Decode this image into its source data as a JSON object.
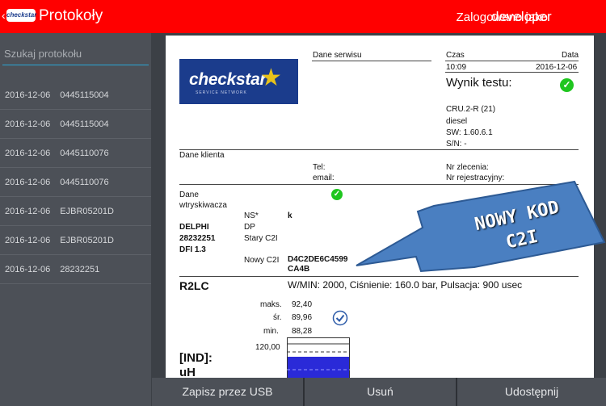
{
  "header": {
    "back_glyph": "‹",
    "logo_text": "checkstar",
    "title": "Protokoły",
    "login_label": "Zalogowano jako",
    "username": "developer"
  },
  "sidebar": {
    "search_placeholder": "Szukaj protokołu",
    "items": [
      {
        "date": "2016-12-06",
        "code": "0445115004"
      },
      {
        "date": "2016-12-06",
        "code": "0445115004"
      },
      {
        "date": "2016-12-06",
        "code": "0445110076"
      },
      {
        "date": "2016-12-06",
        "code": "0445110076"
      },
      {
        "date": "2016-12-06",
        "code": "EJBR05201D"
      },
      {
        "date": "2016-12-06",
        "code": "EJBR05201D"
      },
      {
        "date": "2016-12-06",
        "code": "28232251"
      }
    ]
  },
  "report": {
    "logo_text": "checkstar",
    "logo_sub": "SERVICE NETWORK",
    "service_label": "Dane serwisu",
    "time_label": "Czas",
    "date_label": "Data",
    "time_value": "10:09",
    "date_value": "2016-12-06",
    "result_label": "Wynik testu:",
    "device_model": "CRU.2-R (21)",
    "device_fuel": "diesel",
    "device_sw": "SW: 1.60.6.1",
    "device_sn": "S/N: -",
    "client_label": "Dane klienta",
    "tel_label": "Tel:",
    "email_label": "email:",
    "order_label": "Nr zlecenia:",
    "reg_label": "Nr rejestracyjny:",
    "injector_label_1": "Dane",
    "injector_label_2": "wtryskiwacza",
    "ns_label": "NS*",
    "ns_value": "k",
    "dp_label": "DP",
    "old_c2i_label": "Stary C2I",
    "new_c2i_label": "Nowy C2I",
    "new_c2i_value_1": "D4C2DE6C4599",
    "new_c2i_value_2": "CA4B",
    "maker": "DELPHI",
    "part_no": "28232251",
    "injector_model": "DFI 1.3",
    "test_name": "R2LC",
    "test_params": "W/MIN: 2000, Ciśnienie: 160.0 bar, Pulsacja: 900 usec",
    "max_label": "maks.",
    "max_value": "92,40",
    "avg_label": "śr.",
    "avg_value": "89,96",
    "min_label": "min.",
    "min_value": "88,28",
    "scale_top": "120,00",
    "ind_label_1": "[IND]:",
    "ind_label_2": "uH"
  },
  "callout": {
    "line1": "NOWY KOD",
    "line2": "C2I"
  },
  "buttons": {
    "usb": "Zapisz przez USB",
    "delete": "Usuń",
    "share": "Udostępnij"
  },
  "colors": {
    "header": "#ff0000",
    "sidebar": "#4c5057",
    "accent": "#2aa7d6",
    "ok_green": "#1fc61f",
    "arrow_blue": "#4a7fc1",
    "logo_blue": "#1b3c8c"
  }
}
